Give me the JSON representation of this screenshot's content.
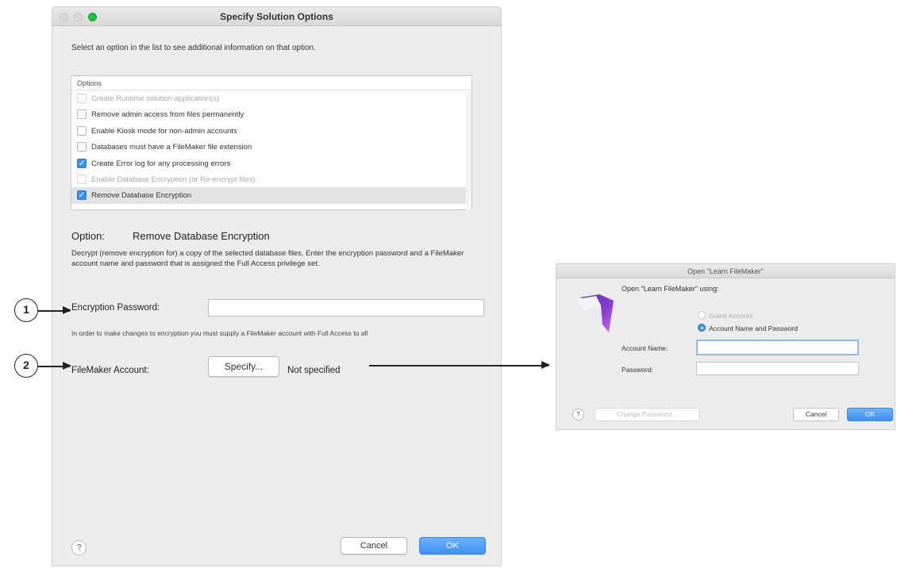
{
  "main_window": {
    "title": "Specify Solution Options",
    "intro": "Select an option in the list to see additional information on that option.",
    "options_header": "Options",
    "options": [
      {
        "label": "Create Runtime solution application(s)",
        "checked": false,
        "enabled": false,
        "selected": false
      },
      {
        "label": "Remove admin access from files permanently",
        "checked": false,
        "enabled": true,
        "selected": false
      },
      {
        "label": "Enable Kiosk mode for non-admin accounts",
        "checked": false,
        "enabled": true,
        "selected": false
      },
      {
        "label": "Databases must have a FileMaker file extension",
        "checked": false,
        "enabled": true,
        "selected": false
      },
      {
        "label": "Create Error log for any processing errors",
        "checked": true,
        "enabled": true,
        "selected": false
      },
      {
        "label": "Enable Database Encryption (or Re-encrypt files)",
        "checked": false,
        "enabled": false,
        "selected": false
      },
      {
        "label": "Remove Database Encryption",
        "checked": true,
        "enabled": true,
        "selected": true
      }
    ],
    "option_label": "Option:",
    "option_name": "Remove Database Encryption",
    "description": "Decrypt (remove encryption for) a copy of the selected database files. Enter the encryption password and a FileMaker account name and password that is assigned the Full Access privilege set.",
    "encryption_password_label": "Encryption Password:",
    "encryption_password_value": "",
    "note": "In order to make changes to encryption you must supply a FileMaker account with Full Access to all",
    "filemaker_account_label": "FileMaker Account:",
    "specify_button": "Specify...",
    "account_status": "Not specified",
    "help": "?",
    "cancel_button": "Cancel",
    "ok_button": "OK"
  },
  "callouts": [
    "1",
    "2"
  ],
  "login_dialog": {
    "title": "Open \"Learn FileMaker\"",
    "prompt": "Open \"Learn FileMaker\" using:",
    "guest_account": "Guest Account",
    "account_name_and_password": "Account Name and Password",
    "selected_mode": "account_name_and_password",
    "account_name_label": "Account Name:",
    "account_name_value": "",
    "password_label": "Password:",
    "password_value": "",
    "help": "?",
    "change_password_button": "Change Password...",
    "cancel_button": "Cancel",
    "ok_button": "OK"
  },
  "icons": {
    "app_icon": "filemaker-icon",
    "checkmark": "✓"
  },
  "colors": {
    "accent": "#3d8fe8",
    "traffic_zoom": "#1fc234"
  }
}
